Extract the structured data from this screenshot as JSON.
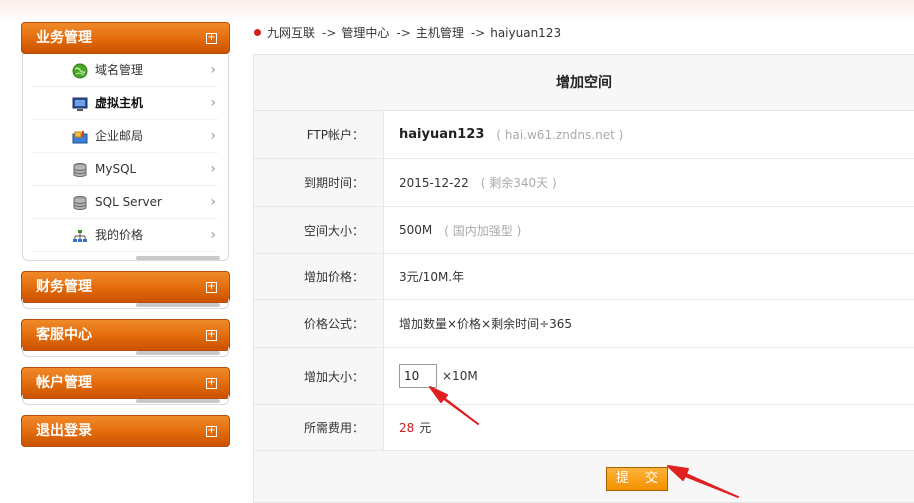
{
  "sidebar": {
    "groups": [
      {
        "title": "业务管理",
        "toggle": "+"
      },
      {
        "title": "财务管理",
        "toggle": "+"
      },
      {
        "title": "客服中心",
        "toggle": "+"
      },
      {
        "title": "帐户管理",
        "toggle": "+"
      },
      {
        "title": "退出登录",
        "toggle": "+"
      }
    ],
    "items": [
      {
        "label": "域名管理",
        "icon": "globe-icon"
      },
      {
        "label": "虚拟主机",
        "icon": "monitor-icon"
      },
      {
        "label": "企业邮局",
        "icon": "mailbox-icon"
      },
      {
        "label": "MySQL",
        "icon": "database-icon"
      },
      {
        "label": "SQL Server",
        "icon": "database-icon"
      },
      {
        "label": "我的价格",
        "icon": "sitemap-icon"
      }
    ],
    "chevron": "›"
  },
  "breadcrumb": {
    "items": [
      "九网互联",
      "管理中心",
      "主机管理",
      "haiyuan123"
    ],
    "separator": "->"
  },
  "form": {
    "title": "增加空间",
    "rows": {
      "ftp": {
        "label": "FTP帐户：",
        "value": "haiyuan123",
        "note": "( hai.w61.zndns.net )"
      },
      "expire": {
        "label": "到期时间：",
        "value": "2015-12-22",
        "note": "( 剩余340天 )"
      },
      "space": {
        "label": "空间大小：",
        "value": "500M",
        "note": "( 国内加强型 )"
      },
      "price": {
        "label": "增加价格：",
        "value": "3元/10M.年"
      },
      "formula": {
        "label": "价格公式：",
        "value": "增加数量×价格×剩余时间÷365"
      },
      "amount": {
        "label": "增加大小：",
        "input_value": "10",
        "unit": "×10M"
      },
      "cost": {
        "label": "所需费用：",
        "value": "28",
        "unit": "元"
      }
    },
    "submit_label": "提 交"
  },
  "colors": {
    "accent": "#e26a0a",
    "button": "#f39200",
    "price_red": "#d02020",
    "arrow_red": "#e02020"
  }
}
